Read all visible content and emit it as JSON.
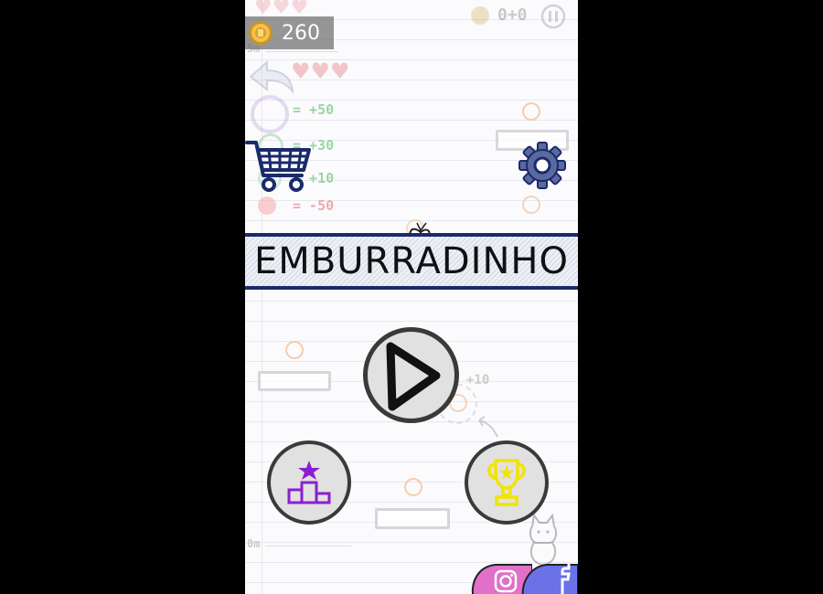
{
  "hud": {
    "coins": "260",
    "score": "0+0",
    "top_distance": "5m",
    "bottom_distance": "0m"
  },
  "legend": {
    "rows": [
      "= +50",
      "= +30",
      "= +10",
      "= -50"
    ],
    "floating_bonus": "+10"
  },
  "title": "EMBURRADINHO",
  "colors": {
    "banner_border": "#1b2a6b",
    "cart": "#1b2a6b",
    "gear": "#5a6aa0",
    "rank_icon": "#8a1fd0",
    "trophy_icon": "#f2e400",
    "instagram": "#e070c8",
    "facebook": "#6b72e8"
  },
  "icons": {
    "coin": "coin-icon",
    "pause": "pause-icon",
    "back": "back-arrow-icon",
    "cart": "shopping-cart-icon",
    "settings": "gear-icon",
    "play": "play-icon",
    "ranking": "podium-star-icon",
    "achievements": "trophy-icon",
    "instagram": "instagram-icon",
    "facebook": "facebook-icon"
  }
}
